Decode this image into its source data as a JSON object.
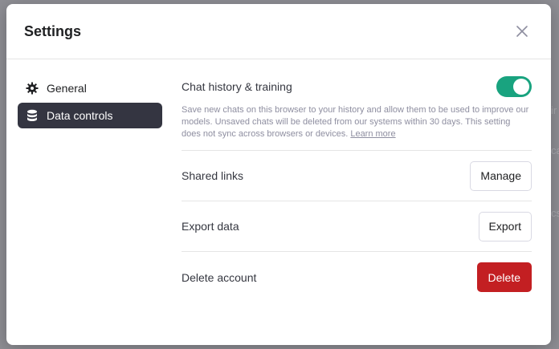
{
  "modal": {
    "title": "Settings"
  },
  "sidebar": {
    "items": [
      {
        "label": "General",
        "icon": "gear-icon",
        "active": false
      },
      {
        "label": "Data controls",
        "icon": "database-icon",
        "active": true
      }
    ]
  },
  "chat_history": {
    "label": "Chat history & training",
    "enabled": true,
    "description": "Save new chats on this browser to your history and allow them to be used to improve our models. Unsaved chats will be deleted from our systems within 30 days. This setting does not sync across browsers or devices.",
    "learn_more": "Learn more"
  },
  "rows": [
    {
      "label": "Shared links",
      "button": "Manage"
    },
    {
      "label": "Export data",
      "button": "Export"
    },
    {
      "label": "Delete account",
      "button": "Delete"
    }
  ],
  "colors": {
    "toggle_on": "#19a37f",
    "danger": "#c31f22",
    "active_nav": "#343541"
  }
}
